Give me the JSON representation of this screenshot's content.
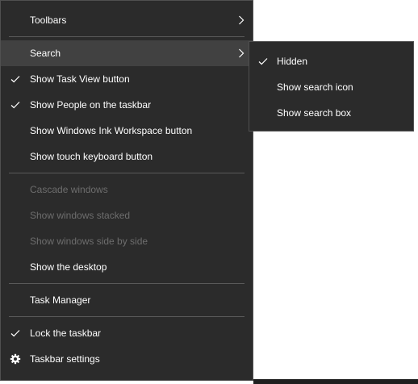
{
  "context_menu": {
    "items": [
      {
        "label": "Toolbars"
      },
      {
        "label": "Search"
      },
      {
        "label": "Show Task View button"
      },
      {
        "label": "Show People on the taskbar"
      },
      {
        "label": "Show Windows Ink Workspace button"
      },
      {
        "label": "Show touch keyboard button"
      },
      {
        "label": "Cascade windows"
      },
      {
        "label": "Show windows stacked"
      },
      {
        "label": "Show windows side by side"
      },
      {
        "label": "Show the desktop"
      },
      {
        "label": "Task Manager"
      },
      {
        "label": "Lock the taskbar"
      },
      {
        "label": "Taskbar settings"
      }
    ]
  },
  "search_submenu": {
    "items": [
      {
        "label": "Hidden"
      },
      {
        "label": "Show search icon"
      },
      {
        "label": "Show search box"
      }
    ]
  },
  "icons": {
    "check": "check-icon",
    "submenu_arrow": "chevron-right-icon",
    "settings": "gear-icon"
  },
  "colors": {
    "menu_background": "#2b2b2b",
    "menu_border": "#505050",
    "highlight": "#414141",
    "text": "#ffffff",
    "disabled_text": "#6d6d6d",
    "separator": "#5a5a5a"
  }
}
